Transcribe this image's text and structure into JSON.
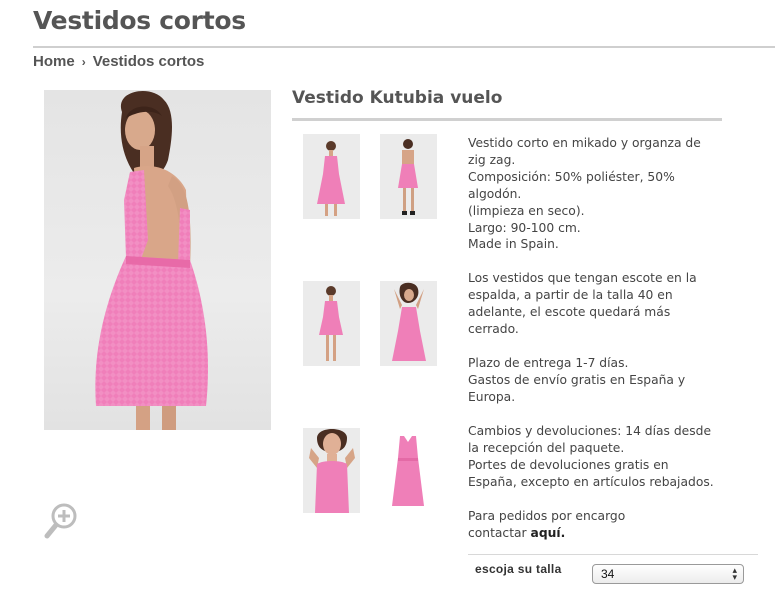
{
  "page": {
    "title": "Vestidos cortos"
  },
  "breadcrumb": {
    "home": "Home",
    "separator": "›",
    "current": "Vestidos cortos"
  },
  "product": {
    "name": "Vestido Kutubia vuelo",
    "description": {
      "block1": [
        "Vestido corto en mikado y organza de",
        "zig zag.",
        "Composición: 50% poliéster, 50%",
        "algodón.",
        "(limpieza en seco).",
        "Largo: 90-100 cm.",
        "Made in Spain."
      ],
      "block2": [
        "Los vestidos que tengan escote en la",
        "espalda, a partir de la talla 40 en",
        "adelante, el escote quedará más",
        "cerrado."
      ],
      "block3": [
        "Plazo de entrega 1-7 días.",
        "Gastos de envío gratis en España y",
        "Europa."
      ],
      "block4": [
        "Cambios y devoluciones: 14 días desde",
        "la recepción del paquete.",
        "Portes de devoluciones gratis en",
        "España, excepto en artículos rebajados."
      ],
      "block5_line1": "Para pedidos por encargo",
      "block5_line2_prefix": "contactar ",
      "block5_link": "aquí."
    },
    "size": {
      "label": "escoja su talla",
      "selected": "34"
    }
  },
  "icons": {
    "zoom": "zoom-in-icon",
    "select_arrows": "up-down-arrows-icon"
  },
  "colors": {
    "dress_pink": "#ef7fb8",
    "title_gray": "#555555"
  }
}
